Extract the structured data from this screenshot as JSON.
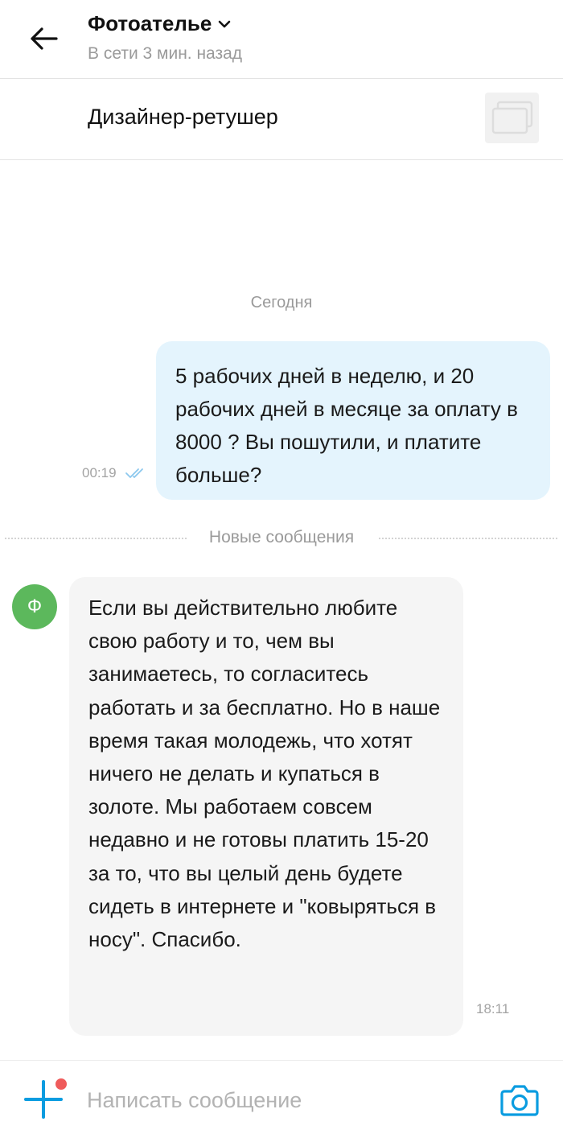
{
  "header": {
    "title": "Фотоателье",
    "status": "В сети 3 мин. назад"
  },
  "job": {
    "title": "Дизайнер-ретушер"
  },
  "chat": {
    "date_separator": "Сегодня",
    "new_messages_label": "Новые сообщения",
    "outgoing": {
      "text": "5 рабочих дней в неделю, и 20 рабочих дней в месяце за оплату в 8000 ? Вы пошутили, и платите больше?",
      "time": "00:19",
      "status_icon": "double-check-icon"
    },
    "incoming": {
      "avatar_letter": "Ф",
      "text": "Если вы действительно любите свою работу и то, чем вы занимаетесь, то согласитесь работать и за бесплатно. Но в наше время такая молодежь, что хотят ничего не делать и купаться в золоте. Мы работаем совсем недавно и не готовы платить 15-20 за то, что вы целый день будете сидеть в интернете и \"ковыряться в носу\". Спасибо.",
      "time": "18:11"
    }
  },
  "composer": {
    "placeholder": "Написать сообщение"
  },
  "colors": {
    "accent": "#0a9ce0",
    "outgoing_bubble": "#e4f4fd",
    "incoming_bubble": "#f5f5f5",
    "avatar": "#5cb85c",
    "notification_dot": "#ef5b5b",
    "read_check": "#8cc8ee"
  }
}
